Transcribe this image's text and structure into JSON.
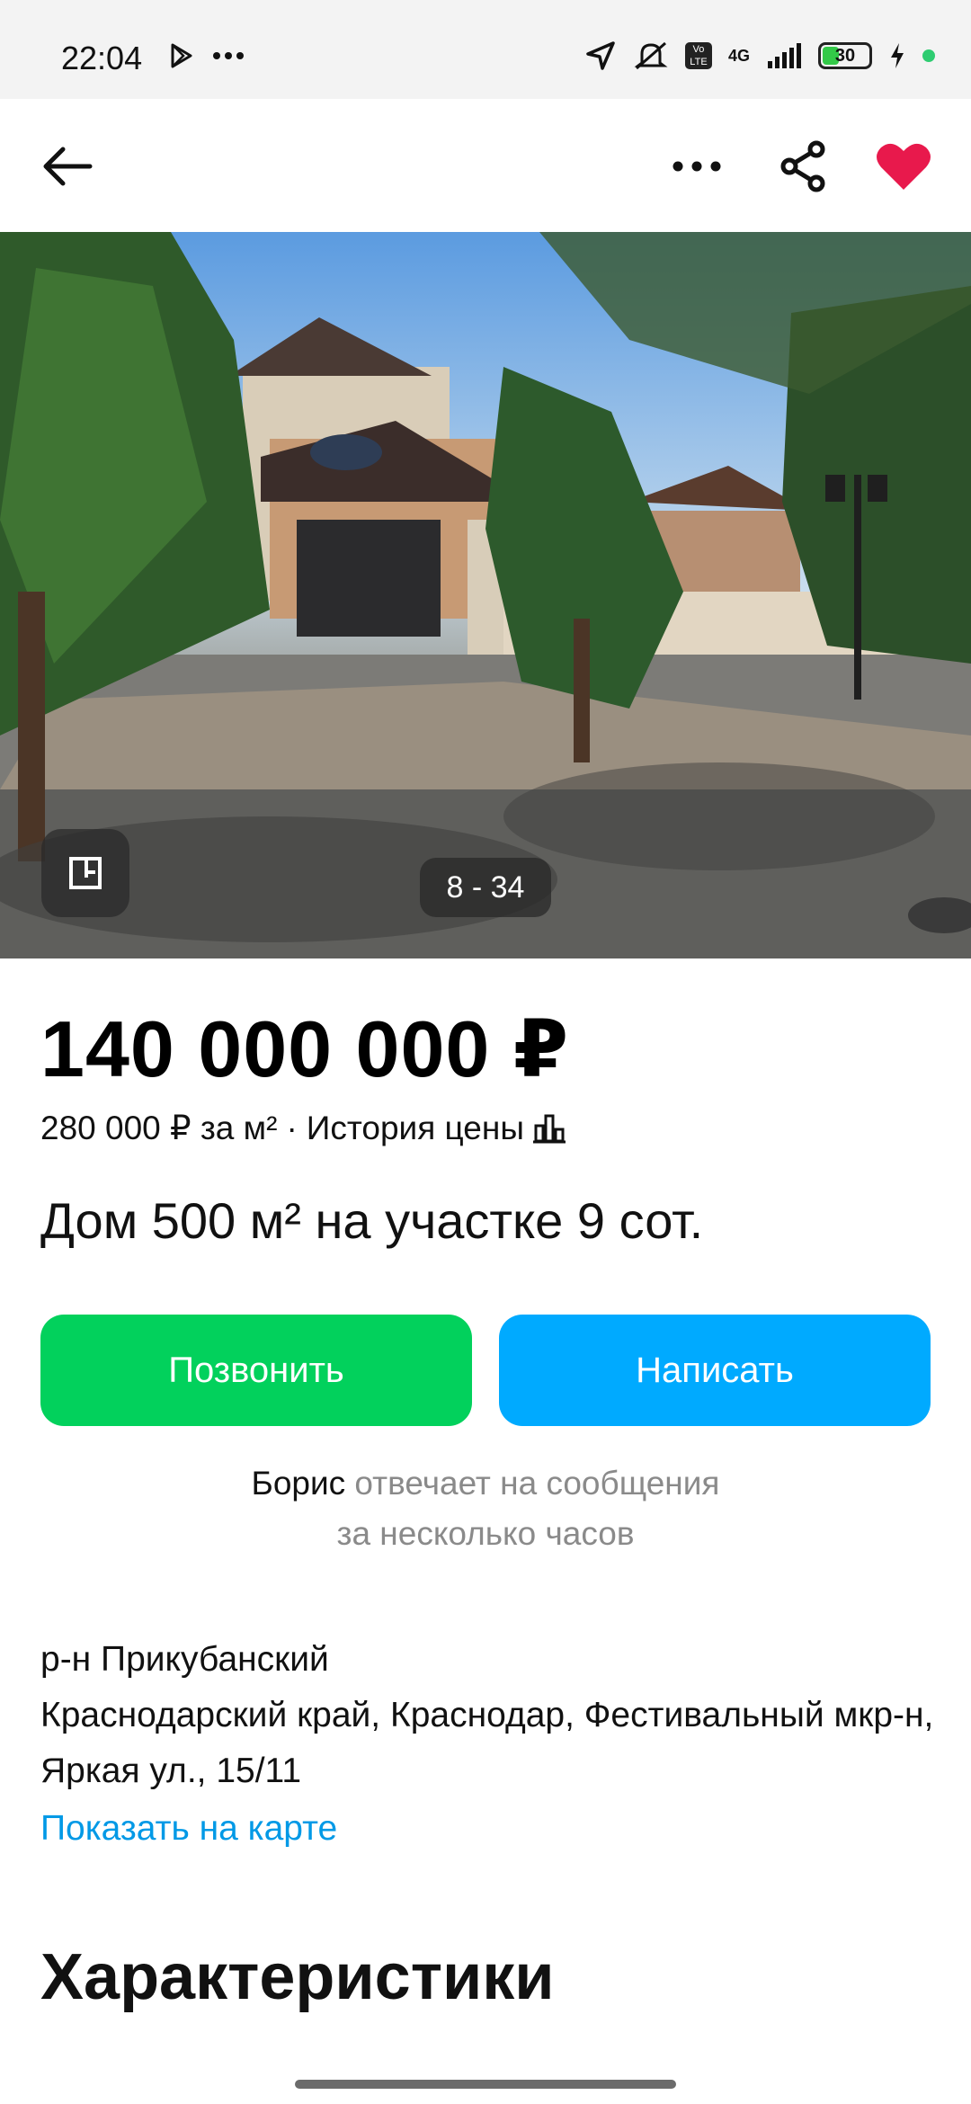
{
  "status_bar": {
    "time": "22:04",
    "battery": "30",
    "network": "4G"
  },
  "photo": {
    "counter": "8 - 34"
  },
  "listing": {
    "price": "140 000 000 ₽",
    "price_per_m2": "280 000 ₽ за м²",
    "separator": "·",
    "price_history": "История цены",
    "title": "Дом 500 м² на участке 9 сот."
  },
  "actions": {
    "call": "Позвонить",
    "write": "Написать"
  },
  "seller": {
    "name": "Борис",
    "response_line1": "отвечает на сообщения",
    "response_line2": "за несколько часов"
  },
  "address": {
    "district": "р-н Прикубанский",
    "full": "Краснодарский край, Краснодар, Фестивальный мкр-н, Яркая ул., 15/11",
    "map_link": "Показать на карте"
  },
  "section_title": "Характеристики",
  "colors": {
    "call_button": "#02d15c",
    "write_button": "#00aaff",
    "link": "#0099e6",
    "favorite": "#e8194c"
  }
}
